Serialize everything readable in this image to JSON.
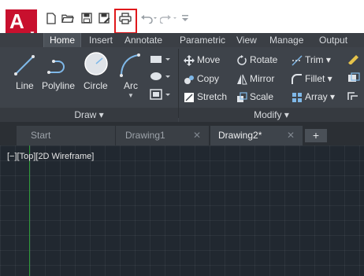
{
  "app": {
    "logo_letter": "A",
    "accent_color": "#c8102e",
    "highlight_color": "#e0181b"
  },
  "quick_access": {
    "items": [
      {
        "name": "new-icon"
      },
      {
        "name": "open-icon"
      },
      {
        "name": "save-icon"
      },
      {
        "name": "save-as-icon"
      },
      {
        "name": "print-icon"
      },
      {
        "name": "undo-icon"
      },
      {
        "name": "redo-icon"
      },
      {
        "name": "customize-icon"
      }
    ]
  },
  "ribbon_tabs": [
    "Home",
    "Insert",
    "Annotate",
    "Parametric",
    "View",
    "Manage",
    "Output"
  ],
  "active_tab": "Home",
  "draw_panel": {
    "tools": [
      "Line",
      "Polyline",
      "Circle",
      "Arc"
    ],
    "footer": "Draw ▾"
  },
  "modify_panel": {
    "rows": [
      [
        "Move",
        "Rotate",
        "Trim ▾"
      ],
      [
        "Copy",
        "Mirror",
        "Fillet ▾"
      ],
      [
        "Stretch",
        "Scale",
        "Array ▾"
      ]
    ],
    "footer": "Modify ▾"
  },
  "file_tabs": [
    {
      "label": "Start",
      "closable": false
    },
    {
      "label": "Drawing1",
      "closable": true
    },
    {
      "label": "Drawing2*",
      "closable": true,
      "active": true
    }
  ],
  "new_tab_symbol": "+",
  "viewport": {
    "label": "[−][Top][2D Wireframe]"
  }
}
